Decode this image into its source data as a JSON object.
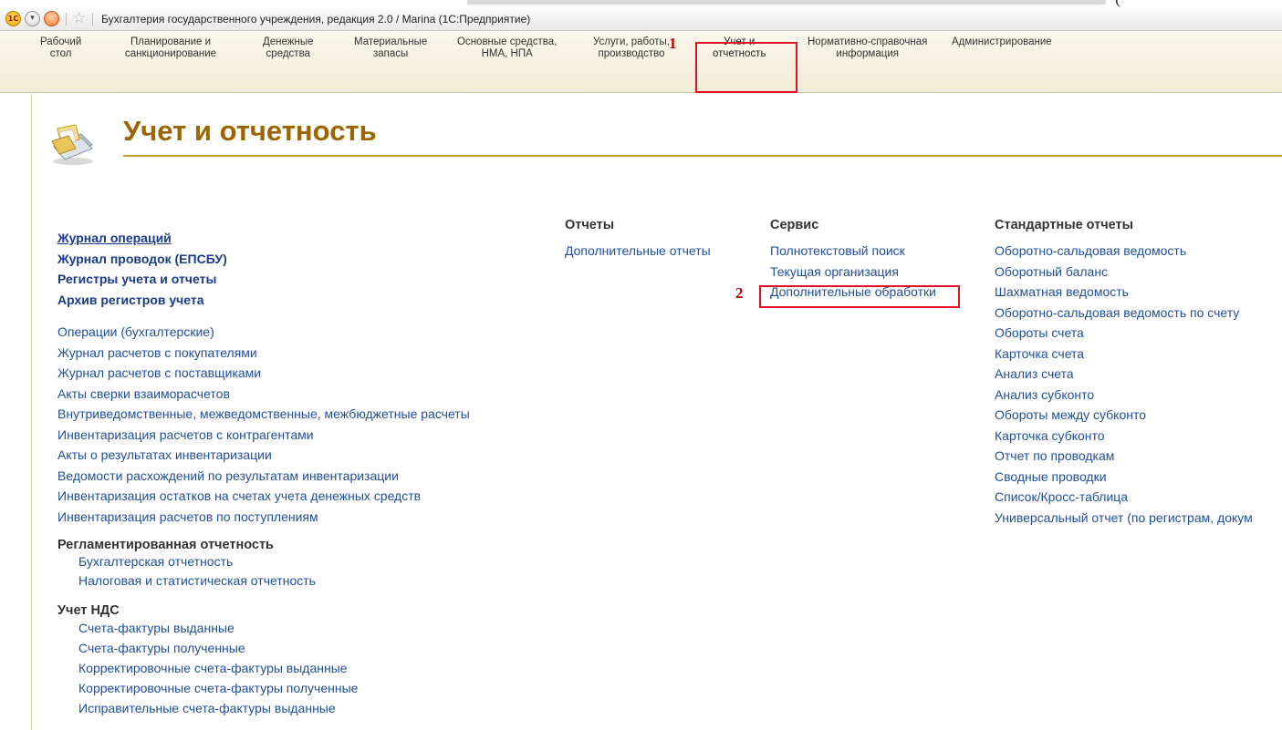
{
  "window": {
    "title": "Бухгалтерия государственного учреждения, редакция 2.0 / Marina  (1С:Предприятие)",
    "above_text": "("
  },
  "sections": [
    {
      "line1": "Рабочий",
      "line2": "стол"
    },
    {
      "line1": "Планирование и",
      "line2": "санкционирование"
    },
    {
      "line1": "Денежные",
      "line2": "средства"
    },
    {
      "line1": "Материальные",
      "line2": "запасы"
    },
    {
      "line1": "Основные средства,",
      "line2": "НМА, НПА"
    },
    {
      "line1": "Услуги, работы,",
      "line2": "производство"
    },
    {
      "line1": "Учет и",
      "line2": "отчетность"
    },
    {
      "line1": "Нормативно-справочная",
      "line2": "информация"
    },
    {
      "line1": "Администрирование",
      "line2": ""
    }
  ],
  "markers": {
    "one": "1",
    "two": "2"
  },
  "page": {
    "title": "Учет и отчетность"
  },
  "left": {
    "bold_links": [
      "Журнал операций",
      "Журнал проводок (ЕПСБУ)",
      "Регистры учета и отчеты",
      "Архив регистров учета"
    ],
    "links": [
      "Операции (бухгалтерские)",
      "Журнал расчетов с покупателями",
      "Журнал расчетов с поставщиками",
      "Акты сверки взаиморасчетов",
      "Внутриведомственные, межведомственные, межбюджетные расчеты",
      "Инвентаризация расчетов с контрагентами",
      "Акты о результатах инвентаризации",
      "Ведомости расхождений по результатам инвентаризации",
      "Инвентаризация остатков на счетах учета денежных средств",
      "Инвентаризация расчетов по поступлениям"
    ],
    "group1": {
      "title": "Регламентированная отчетность",
      "items": [
        "Бухгалтерская отчетность",
        "Налоговая и статистическая отчетность"
      ]
    },
    "group2": {
      "title": "Учет НДС",
      "items": [
        "Счета-фактуры выданные",
        "Счета-фактуры полученные",
        "Корректировочные счета-фактуры выданные",
        "Корректировочные счета-фактуры полученные",
        "Исправительные счета-фактуры выданные"
      ]
    }
  },
  "reports": {
    "title": "Отчеты",
    "items": [
      "Дополнительные отчеты"
    ]
  },
  "service": {
    "title": "Сервис",
    "items": [
      "Полнотекстовый поиск",
      "Текущая организация",
      "Дополнительные обработки"
    ]
  },
  "standard": {
    "title": "Стандартные отчеты",
    "items": [
      "Оборотно-сальдовая ведомость",
      "Оборотный баланс",
      "Шахматная ведомость",
      "Оборотно-сальдовая ведомость по счету",
      "Обороты счета",
      "Карточка счета",
      "Анализ счета",
      "Анализ субконто",
      "Обороты между субконто",
      "Карточка субконто",
      "Отчет по проводкам",
      "Сводные проводки",
      "Список/Кросс-таблица",
      "Универсальный отчет (по регистрам, докум"
    ]
  }
}
